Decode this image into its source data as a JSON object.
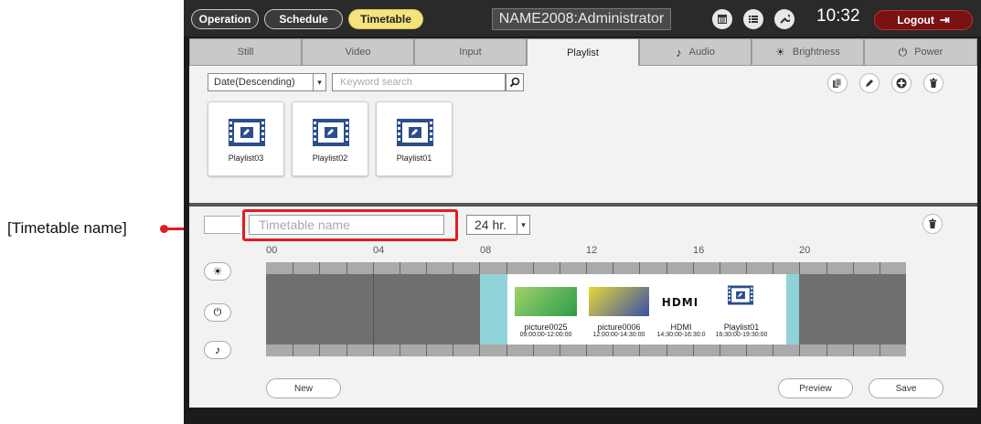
{
  "callout": {
    "label": "[Timetable name]"
  },
  "topbar": {
    "tabs": [
      "Operation",
      "Schedule",
      "Timetable"
    ],
    "title": "NAME2008:Administrator",
    "clock": "10:32",
    "logout": "Logout"
  },
  "tabs": {
    "still": "Still",
    "video": "Video",
    "input": "Input",
    "playlist": "Playlist",
    "audio": "Audio",
    "brightness": "Brightness",
    "power": "Power"
  },
  "upper": {
    "sort_value": "Date(Descending)",
    "search_placeholder": "Keyword search",
    "cards": [
      "Playlist03",
      "Playlist02",
      "Playlist01"
    ]
  },
  "lower": {
    "name_placeholder": "Timetable name",
    "hours_value": "24 hr.",
    "hour_labels": [
      "00",
      "04",
      "08",
      "12",
      "16",
      "20"
    ],
    "items": [
      {
        "label": "picture0025",
        "time": "09:00:00-12:00:00"
      },
      {
        "label": "picture0006",
        "time": "12:00:00-14:30:00"
      },
      {
        "label": "HDMI",
        "time": "14:30:00-16:30:0"
      },
      {
        "label": "Playlist01",
        "time": "16:30:00-19:30:00"
      }
    ],
    "hdmi_logo": "HDMI",
    "new_btn": "New",
    "preview_btn": "Preview",
    "save_btn": "Save"
  }
}
